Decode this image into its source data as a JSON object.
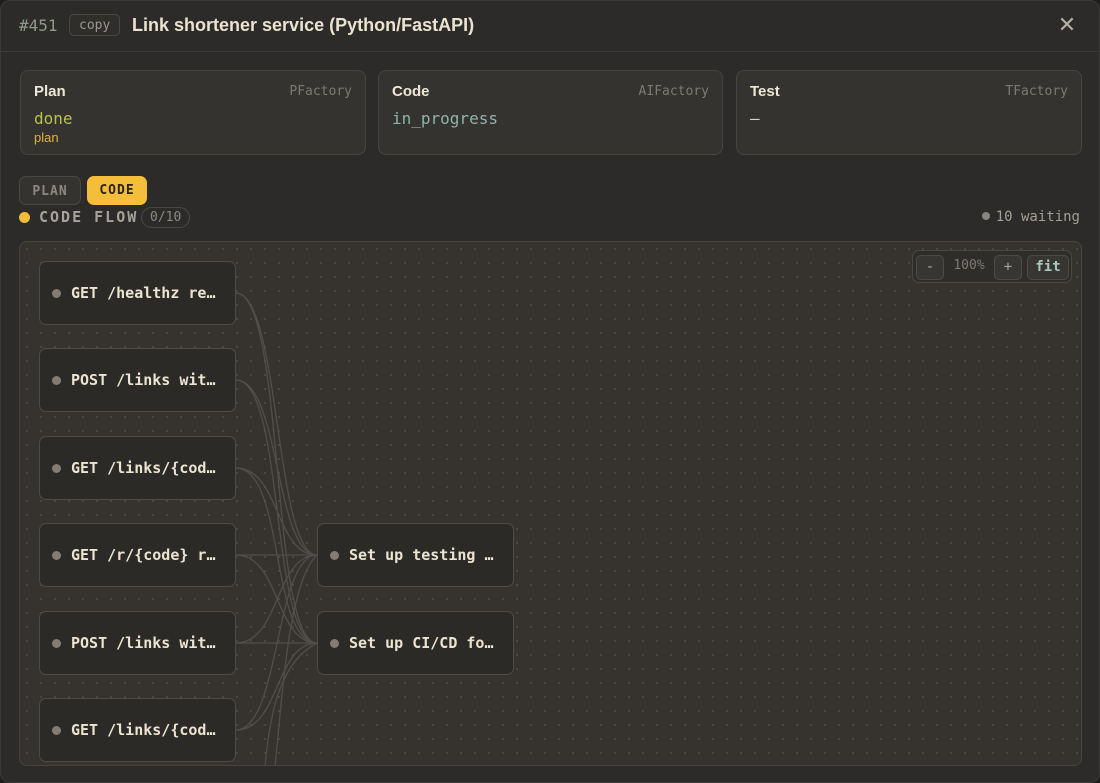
{
  "header": {
    "issue_id": "#451",
    "copy_label": "copy",
    "title": "Link shortener service (Python/FastAPI)",
    "close_glyph": "✕"
  },
  "stages": [
    {
      "name": "Plan",
      "factory": "PFactory",
      "status": "done",
      "status_color": "#b8c24a",
      "sub": "plan"
    },
    {
      "name": "Code",
      "factory": "AIFactory",
      "status": "in_progress",
      "status_color": "#8fb4ac",
      "sub": ""
    },
    {
      "name": "Test",
      "factory": "TFactory",
      "status": "—",
      "status_color": "#d8d2c4",
      "sub": ""
    }
  ],
  "tabs": {
    "plan": "PLAN",
    "code": "CODE",
    "active": "CODE"
  },
  "flow": {
    "label": "CODE FLOW",
    "count": "0/10",
    "waiting": "10 waiting"
  },
  "zoom": {
    "minus": "-",
    "percent": "100%",
    "plus": "+",
    "fit": "fit"
  },
  "nodes": [
    {
      "label": "GET /healthz re…"
    },
    {
      "label": "POST /links wit…"
    },
    {
      "label": "GET /links/{cod…"
    },
    {
      "label": "GET /r/{code} r…"
    },
    {
      "label": "POST /links wit…"
    },
    {
      "label": "GET /links/{cod…"
    },
    {
      "label": "Set up testing …"
    },
    {
      "label": "Set up CI/CD fo…"
    }
  ],
  "colors": {
    "accent": "#f5be3a",
    "background": "#2c2b29",
    "node": "#2b2a27"
  }
}
